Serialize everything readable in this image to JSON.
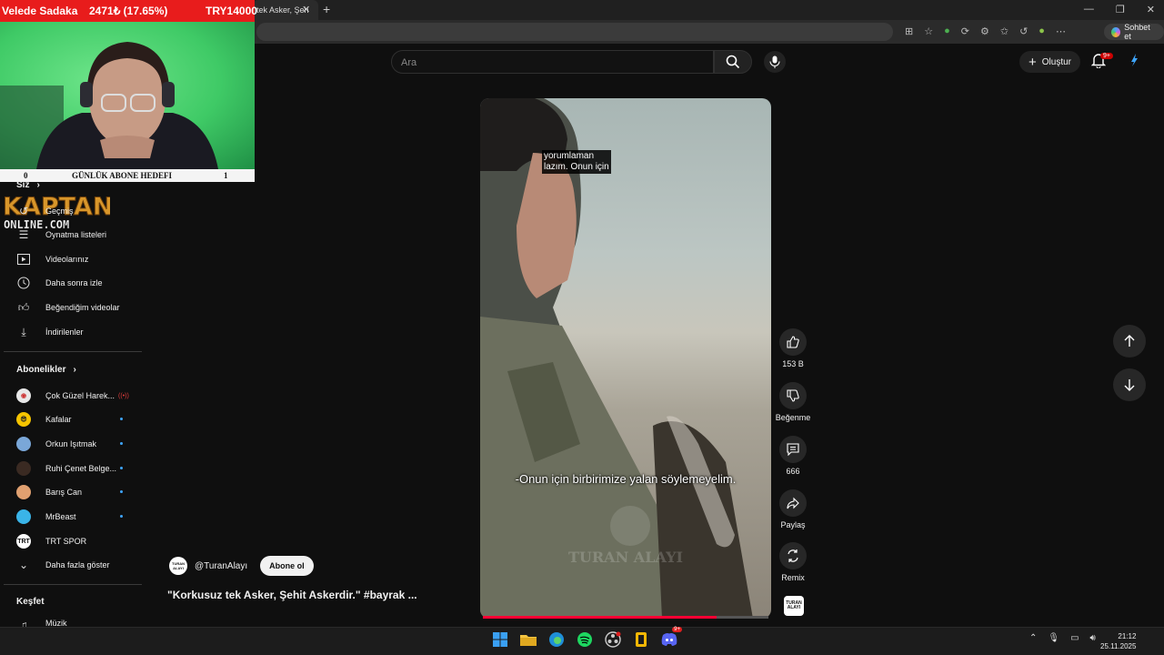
{
  "stream_overlay": {
    "donation_name": "Velede Sadaka",
    "donation_percent": "2471₺ (17.65%)",
    "donation_target": "TRY14000",
    "goal_start": "0",
    "goal_label": "GÜNLÜK ABONE HEDEFI",
    "goal_end": "1",
    "logo_top": "KAPTAN",
    "logo_bottom": "ONLINE.COM"
  },
  "browser": {
    "tab_title": "tek Asker, Şeh",
    "copilot_label": "Sohbet et"
  },
  "header": {
    "search_placeholder": "Ara",
    "create_label": "Oluştur",
    "notification_count": "9+"
  },
  "sidebar": {
    "you_heading": "Siz",
    "you_items": [
      {
        "label": "Geçmiş",
        "icon": "history-icon"
      },
      {
        "label": "Oynatma listeleri",
        "icon": "playlist-icon"
      },
      {
        "label": "Videolarınız",
        "icon": "video-icon"
      },
      {
        "label": "Daha sonra izle",
        "icon": "clock-icon"
      },
      {
        "label": "Beğendiğim videolar",
        "icon": "thumbs-up-icon"
      },
      {
        "label": "İndirilenler",
        "icon": "download-icon"
      }
    ],
    "subs_heading": "Abonelikler",
    "subscriptions": [
      {
        "label": "Çok Güzel Harek...",
        "badge": "live",
        "color": "#e8e8e8"
      },
      {
        "label": "Kafalar",
        "badge": "dot",
        "color": "#f5c400"
      },
      {
        "label": "Orkun Işıtmak",
        "badge": "dot",
        "color": "#7aa7d8"
      },
      {
        "label": "Ruhi Çenet Belge...",
        "badge": "dot",
        "color": "#3a2a22"
      },
      {
        "label": "Barış Can",
        "badge": "dot",
        "color": "#e0a070"
      },
      {
        "label": "MrBeast",
        "badge": "dot",
        "color": "#3ab4e8"
      },
      {
        "label": "TRT SPOR",
        "badge": "",
        "color": "#ffffff"
      }
    ],
    "trt_avatar_text": "TRT",
    "show_more": "Daha fazla göster",
    "explore_heading": "Keşfet",
    "explore_first": "Müzik"
  },
  "video": {
    "caption_top": "yorumlaman\nlazım. Onun için",
    "caption_bottom": "-Onun için birbirimize yalan söylemeyelim.",
    "watermark": "TURAN ALAYI",
    "progress": 0.82,
    "channel_handle": "@TuranAlayı",
    "channel_logo_text": "TURAN ALAYI",
    "subscribe_label": "Abone ol",
    "title": "\"Korkusuz tek Asker, Şehit Askerdir.\" #bayrak ..."
  },
  "actions": {
    "like_count": "153 B",
    "dislike_label": "Beğenme",
    "comment_count": "666",
    "share_label": "Paylaş",
    "remix_label": "Remix"
  },
  "taskbar": {
    "time": "21:12",
    "date": "25.11.2025",
    "discord_badge": "9+"
  }
}
